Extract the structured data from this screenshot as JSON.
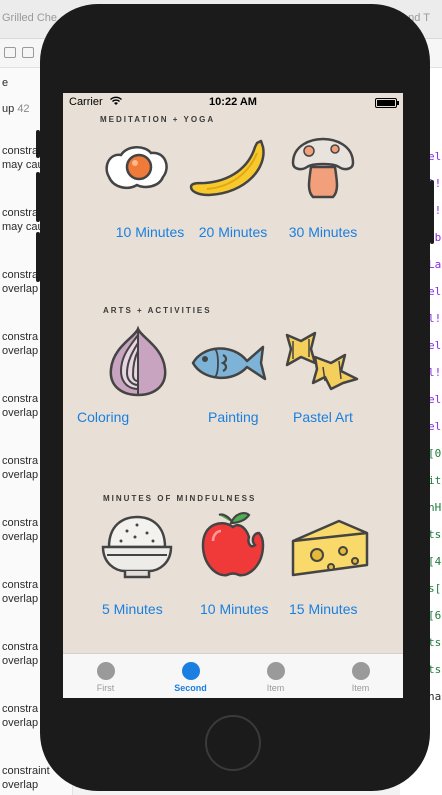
{
  "ide": {
    "tabs": [
      "Grilled Che",
      "and T"
    ],
    "sidebar_header": "e",
    "sidebar_count_label": "up",
    "sidebar_count": "42",
    "sidebar_rows": [
      "constra",
      "may cau",
      "constra",
      "may cau",
      "constra",
      "overlap",
      "constra",
      "overlap",
      "constra",
      "overlap",
      "constra",
      "overlap",
      "constra",
      "overlap",
      "constra",
      "overlap",
      "constra",
      "overlap",
      "constra",
      "overlap",
      "constraint",
      "overlap"
    ],
    "right_code": [
      {
        "text": "ele",
        "color": "#8a2be2"
      },
      {
        "text": "l!",
        "color": "#8a2be2"
      },
      {
        "text": "l!",
        "color": "#8a2be2"
      },
      {
        "text": "abe",
        "color": "#8a2be2"
      },
      {
        "text": "La",
        "color": "#8a2be2"
      },
      {
        "text": "el!",
        "color": "#8a2be2"
      },
      {
        "text": "l!",
        "color": "#8a2be2"
      },
      {
        "text": "el!",
        "color": "#8a2be2"
      },
      {
        "text": "l!",
        "color": "#8a2be2"
      },
      {
        "text": "el",
        "color": "#8a2be2"
      },
      {
        "text": "el",
        "color": "#8a2be2"
      },
      {
        "text": "[0",
        "color": "#1d7d3a"
      },
      {
        "text": "it",
        "color": "#1d7d3a"
      },
      {
        "text": "nH",
        "color": "#1d7d3a"
      },
      {
        "text": "ts",
        "color": "#1d7d3a"
      },
      {
        "text": "[4",
        "color": "#1d7d3a"
      },
      {
        "text": "s[",
        "color": "#1d7d3a"
      },
      {
        "text": "[6",
        "color": "#1d7d3a"
      },
      {
        "text": "ts",
        "color": "#1d7d3a"
      },
      {
        "text": "ts",
        "color": "#1d7d3a"
      },
      {
        "text": "nas",
        "color": "#2b2b2b"
      }
    ]
  },
  "status_bar": {
    "carrier": "Carrier",
    "time": "10:22 AM"
  },
  "sections": [
    {
      "title": "MEDITATION + YOGA",
      "items": [
        {
          "icon": "fried-egg-icon",
          "label": "10 Minutes"
        },
        {
          "icon": "banana-icon",
          "label": "20 Minutes"
        },
        {
          "icon": "mushroom-icon",
          "label": "30 Minutes"
        }
      ]
    },
    {
      "title": "ARTS + ACTIVITIES",
      "items": [
        {
          "icon": "onion-icon",
          "label": "Coloring"
        },
        {
          "icon": "fish-icon",
          "label": "Painting"
        },
        {
          "icon": "pasta-icon",
          "label": "Pastel Art"
        }
      ]
    },
    {
      "title": "MINUTES OF MINDFULNESS",
      "items": [
        {
          "icon": "rice-bowl-icon",
          "label": "5 Minutes"
        },
        {
          "icon": "apple-icon",
          "label": "10 Minutes"
        },
        {
          "icon": "cheese-icon",
          "label": "15 Minutes"
        }
      ]
    }
  ],
  "tab_bar": {
    "items": [
      {
        "label": "First",
        "active": false
      },
      {
        "label": "Second",
        "active": true
      },
      {
        "label": "Item",
        "active": false
      },
      {
        "label": "Item",
        "active": false
      }
    ]
  },
  "colors": {
    "accent": "#1a7fe0",
    "screen_bg": "#e8e0d6",
    "phone": "#1b1b1b"
  }
}
